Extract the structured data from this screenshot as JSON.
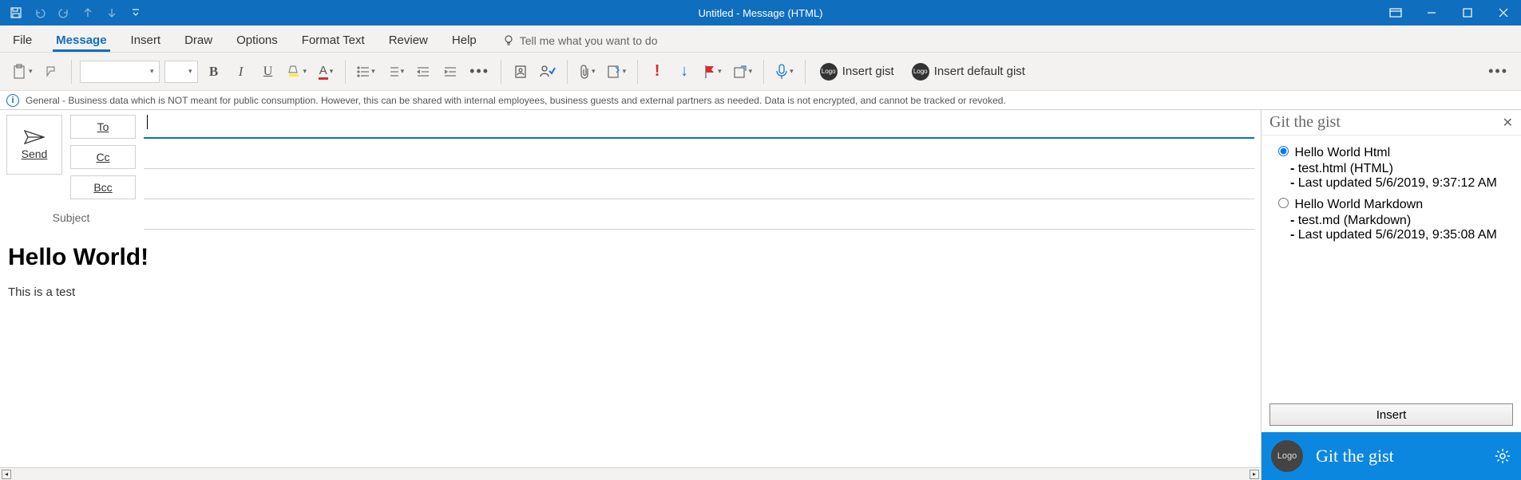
{
  "window": {
    "title": "Untitled  -  Message (HTML)"
  },
  "tabs": [
    "File",
    "Message",
    "Insert",
    "Draw",
    "Options",
    "Format Text",
    "Review",
    "Help"
  ],
  "active_tab": "Message",
  "tellme": "Tell me what you want to do",
  "addins": {
    "insert_gist": "Insert gist",
    "insert_default_gist": "Insert default gist",
    "logo_text": "Logo"
  },
  "infobar": "General - Business data which is NOT meant for public consumption. However, this can be shared with internal employees, business guests and external partners as needed. Data is not encrypted, and cannot be tracked or revoked.",
  "compose": {
    "send": "Send",
    "to": "To",
    "cc": "Cc",
    "bcc": "Bcc",
    "subject_label": "Subject",
    "subject_value": "",
    "body_heading": "Hello World!",
    "body_text": "This is a test"
  },
  "pane": {
    "title": "Git the gist",
    "gists": [
      {
        "name": "Hello World Html",
        "file": "test.html (HTML)",
        "updated": "Last updated 5/6/2019, 9:37:12 AM",
        "selected": true
      },
      {
        "name": "Hello World Markdown",
        "file": "test.md (Markdown)",
        "updated": "Last updated 5/6/2019, 9:35:08 AM",
        "selected": false
      }
    ],
    "insert": "Insert",
    "footer_title": "Git the gist",
    "footer_logo": "Logo"
  }
}
